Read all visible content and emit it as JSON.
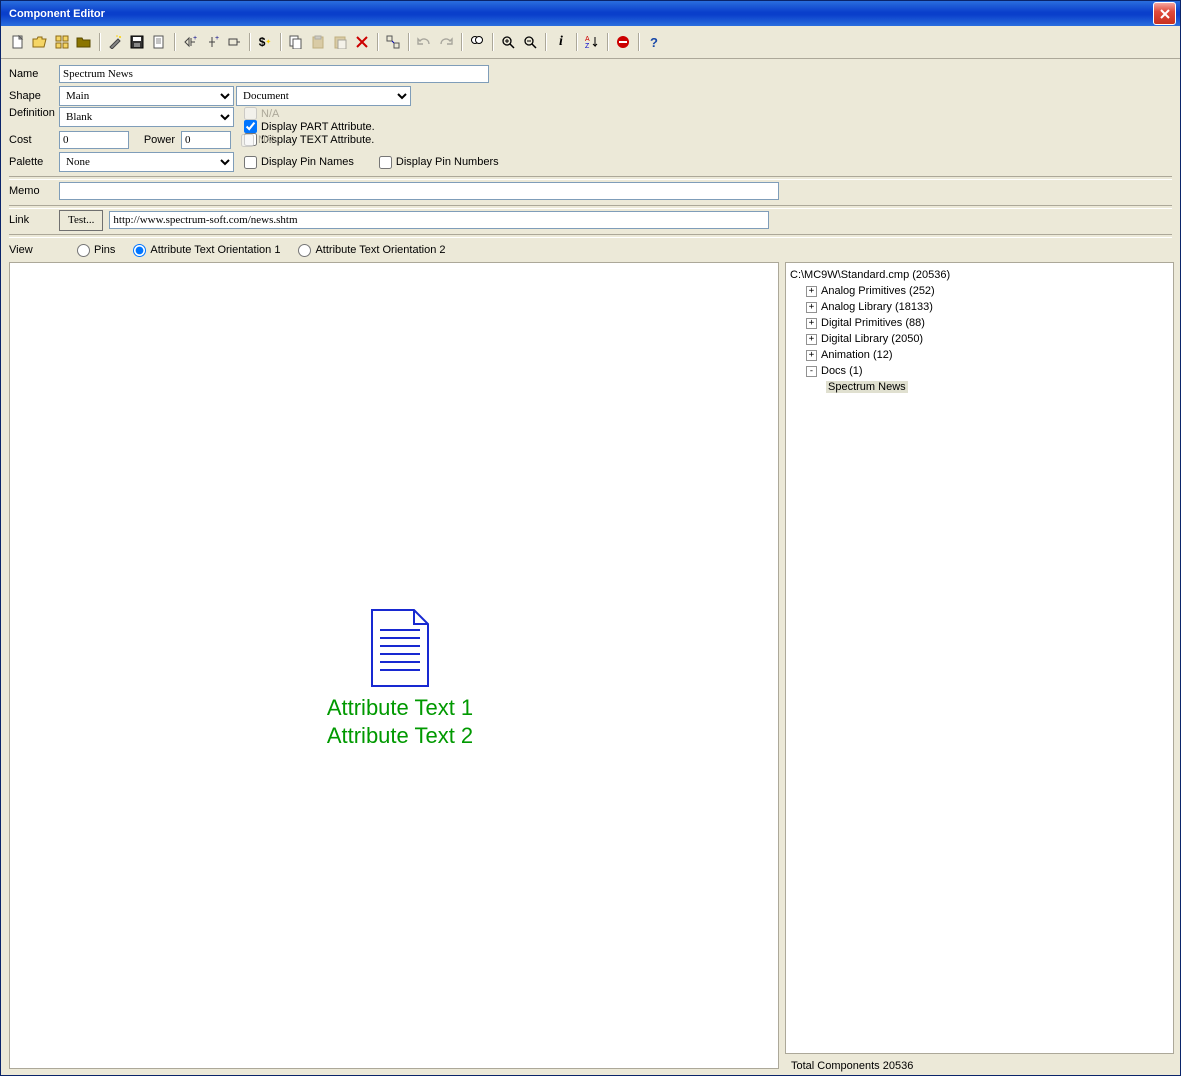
{
  "window": {
    "title": "Component Editor"
  },
  "labels": {
    "name": "Name",
    "shape": "Shape",
    "definition": "Definition",
    "cost": "Cost",
    "power": "Power",
    "palette": "Palette",
    "memo": "Memo",
    "link": "Link",
    "view": "View",
    "test": "Test..."
  },
  "fields": {
    "name": "Spectrum News",
    "shape": "Main",
    "shape2": "Document",
    "definition": "Blank",
    "cost": "0",
    "power": "0",
    "palette": "None",
    "memo": "",
    "link": "http://www.spectrum-soft.com/news.shtm"
  },
  "checks": {
    "na1": "N/A",
    "displayPart": "Display PART Attribute.",
    "displayText": "Display TEXT Attribute.",
    "na2": "N/A",
    "displayPinNames": "Display Pin Names",
    "displayPinNumbers": "Display Pin Numbers"
  },
  "view": {
    "pins": "Pins",
    "attr1": "Attribute Text Orientation 1",
    "attr2": "Attribute Text Orientation 2"
  },
  "canvas": {
    "attr1": "Attribute Text 1",
    "attr2": "Attribute Text 2"
  },
  "tree": {
    "root": "C:\\MC9W\\Standard.cmp (20536)",
    "nodes": [
      {
        "label": "Analog Primitives (252)",
        "expanded": false
      },
      {
        "label": "Analog Library (18133)",
        "expanded": false
      },
      {
        "label": "Digital Primitives (88)",
        "expanded": false
      },
      {
        "label": "Digital Library (2050)",
        "expanded": false
      },
      {
        "label": "Animation (12)",
        "expanded": false
      },
      {
        "label": "Docs (1)",
        "expanded": true,
        "children": [
          "Spectrum News"
        ]
      }
    ]
  },
  "status": "Total Components 20536",
  "icons": {
    "new": "new",
    "open": "open",
    "grid1": "grid",
    "folder": "folder",
    "wizard": "wizard",
    "save": "save",
    "page": "page",
    "add1": "add-part",
    "add2": "add-part2",
    "add3": "add-part3",
    "dollar": "cost",
    "copy": "copy",
    "paste": "paste",
    "paste2": "paste2",
    "delete": "delete",
    "merge": "merge",
    "undo": "undo",
    "redo": "redo",
    "find": "find",
    "zoomin": "zoom-in",
    "zoomout": "zoom-out",
    "info": "info",
    "sort": "sort",
    "stop": "stop",
    "help": "help"
  }
}
